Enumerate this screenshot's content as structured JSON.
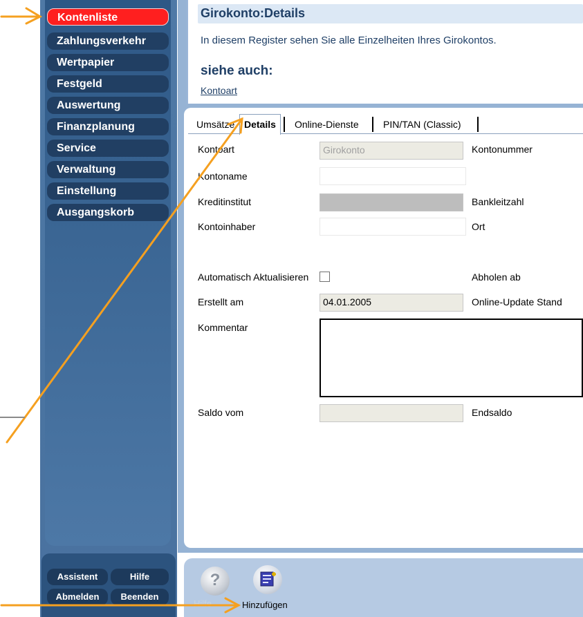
{
  "nav": {
    "items": [
      {
        "label": "Kontenliste",
        "active": true
      },
      {
        "label": "Zahlungsverkehr"
      },
      {
        "label": "Wertpapier"
      },
      {
        "label": "Festgeld"
      },
      {
        "label": "Auswertung"
      },
      {
        "label": "Finanzplanung"
      },
      {
        "label": "Service"
      },
      {
        "label": "Verwaltung"
      },
      {
        "label": "Einstellung"
      },
      {
        "label": "Ausgangskorb"
      }
    ],
    "bottom": {
      "assistent": "Assistent",
      "hilfe": "Hilfe",
      "abmelden": "Abmelden",
      "beenden": "Beenden"
    }
  },
  "help": {
    "title": "Girokonto:Details",
    "text": "In diesem Register sehen Sie alle Einzelheiten Ihres Girokontos.",
    "see_also": "siehe auch:",
    "link": "Kontoart"
  },
  "tabs": [
    {
      "label": "Umsätze"
    },
    {
      "label": "Details",
      "active": true
    },
    {
      "label": "Online-Dienste"
    },
    {
      "label": "PIN/TAN (Classic)"
    }
  ],
  "form": {
    "kontoart_label": "Kontoart",
    "kontoart_value": "Girokonto",
    "kontonummer_label": "Kontonummer",
    "kontoname_label": "Kontoname",
    "kontoname_value": "",
    "kreditinstitut_label": "Kreditinstitut",
    "kreditinstitut_value": "",
    "bankleitzahl_label": "Bankleitzahl",
    "kontoinhaber_label": "Kontoinhaber",
    "kontoinhaber_value": "",
    "ort_label": "Ort",
    "auto_label": "Automatisch Aktualisieren",
    "auto_checked": false,
    "abholen_label": "Abholen ab",
    "erstellt_label": "Erstellt am",
    "erstellt_value": "04.01.2005",
    "online_update_label": "Online-Update Stand",
    "kommentar_label": "Kommentar",
    "kommentar_value": "",
    "saldo_label": "Saldo vom",
    "saldo_value": "",
    "endsaldo_label": "Endsaldo"
  },
  "toolbar": {
    "hilfe_label": "Hilfe",
    "hinzufuegen_label": "Hinzufügen"
  },
  "colors": {
    "accent_arrow": "#f5a020",
    "active_nav": "#ff1f1f",
    "nav_item": "#213f63"
  }
}
